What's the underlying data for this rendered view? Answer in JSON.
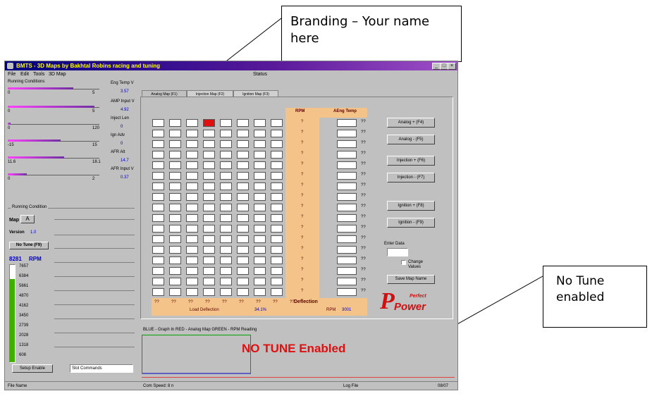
{
  "callouts": {
    "branding": "Branding – Your name here",
    "no_tune": "No Tune enabled"
  },
  "window": {
    "title": "BMTS - 3D Maps   by  Bakhtal Robins racing and tuning",
    "menu": [
      "File",
      "Edit",
      "Tools",
      "3D Map"
    ],
    "status_label": "Status",
    "running_conditions_label": "Running Conditions",
    "gauges": [
      {
        "name": "Eng Temp V",
        "left": "0",
        "right": "5",
        "reading": "3.57",
        "level": 0.62,
        "color": "#7030a0"
      },
      {
        "name": "AMP Input V",
        "left": "0",
        "right": "5",
        "reading": "4.92",
        "level": 0.82,
        "color": "#7030a0"
      },
      {
        "name": "Inject Len",
        "left": "0",
        "right": "120",
        "reading": "0",
        "level": 0.0,
        "color": "#7030a0"
      },
      {
        "name": "Ign Adv",
        "left": "-15",
        "right": "15",
        "reading": "0",
        "level": 0.5,
        "color": "#7030a0"
      },
      {
        "name": "AFR Alt",
        "left": "11.6",
        "right": "18.1",
        "reading": "14.7",
        "level": 0.53,
        "color": "#7030a0"
      },
      {
        "name": "AFR Input V",
        "left": "0",
        "right": "2",
        "reading": "0.37",
        "level": 0.18,
        "color": "#7030a0"
      }
    ],
    "running_condition_group": "Running Condition",
    "map_label": "Map",
    "map_value": "A",
    "version_label": "Version",
    "version_value": "1.0",
    "no_tune_button": "No Tune (F9)",
    "rpm_value": "8281",
    "rpm_label": "RPM",
    "rpm_scale": [
      "7657",
      "6384",
      "5661",
      "4870",
      "4162",
      "3450",
      "2739",
      "2028",
      "1318",
      "608"
    ],
    "bottom_left": {
      "setup_button": "Setup Enable",
      "commands": "Slot Commands"
    },
    "tabs": [
      "Analog Map (F1)",
      "Injection Map (F2)",
      "Ignition Map (F3)"
    ],
    "grid_headers": {
      "rpm": "RPM",
      "afr_temp": "AEng Temp"
    },
    "grid_rows": [
      "?",
      "?",
      "?",
      "?",
      "?",
      "?",
      "?",
      "?",
      "?",
      "?",
      "?",
      "?",
      "?",
      "?",
      "?",
      "?",
      "?"
    ],
    "right_col_values": [
      "??",
      "??",
      "??",
      "??",
      "??",
      "??",
      "??",
      "??",
      "??",
      "??",
      "??",
      "??",
      "??",
      "??",
      "??",
      "??",
      "??"
    ],
    "load_values": [
      "??",
      "??",
      "??",
      "??",
      "??",
      "??",
      "??",
      "??",
      "??"
    ],
    "deflection_label": "Deflection",
    "load_deflection_label": "Load Deflection",
    "load_deflection_value": "34.1%",
    "rpm_small_label": "RPM",
    "rpm_small_value": "3001",
    "buttons": [
      "Analog + (F4)",
      "Analog - (F5)",
      "Injection + (F6)",
      "Injection - (F7)",
      "Ignition + (F8)",
      "Ignition - (F9)"
    ],
    "enter_data_label": "Enter Data",
    "change_values_label": "Change Values",
    "save_map_button": "Save Map Name",
    "legend_text": "BLUE - Graph In      RED - Analog Map      GREEN - RPM Reading",
    "no_tune_message": "NO TUNE Enabled",
    "logo_top": "Perfect",
    "logo_bottom": "Power",
    "status_bar": {
      "left": "File Name",
      "middle": "Com Speed: 8 n",
      "log": "Log File",
      "right": "08/07"
    }
  }
}
